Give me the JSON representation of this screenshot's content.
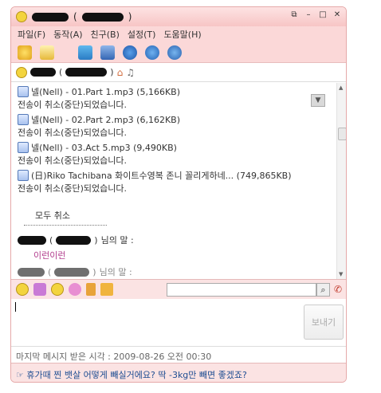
{
  "window": {
    "title_paren_open": "(",
    "title_paren_close": ")",
    "controls": [
      "⧉",
      "–",
      "□",
      "✕"
    ]
  },
  "menu": [
    "파일(F)",
    "동작(A)",
    "친구(B)",
    "설정(T)",
    "도움말(H)"
  ],
  "contact": {
    "paren_open": "(",
    "paren_close": ")"
  },
  "transfers": [
    {
      "file": "넬(Nell) - 01.Part 1.mp3 (5,166KB)",
      "status": "전송이 취소(중단)되었습니다."
    },
    {
      "file": "넬(Nell) - 02.Part 2.mp3 (6,162KB)",
      "status": "전송이 취소(중단)되었습니다."
    },
    {
      "file": "넬(Nell) - 03.Act 5.mp3 (9,490KB)",
      "status": "전송이 취소(중단)되었습니다."
    },
    {
      "file": "(日)Riko Tachibana 화이트수영복 존니 꼴리게하네... (749,865KB)",
      "status": "전송이 취소(중단)되었습니다."
    }
  ],
  "cancel_all": "모두 취소",
  "message": {
    "sender_paren_open": "(",
    "sender_paren_close": ")",
    "says": "님의 말 :",
    "text": "이런이런",
    "next_says": "님의 말 :"
  },
  "send_button": "보내기",
  "last_message": "마지막 메시지 받은 시각 : 2009-08-26 오전 00:30",
  "ad": "☞ 휴가때 찐 뱃살 어떻게 빼실거에요? 딱 -3kg만 빼면 좋겠죠?",
  "colors": {
    "title_bg": "#f7c5c5",
    "menu_bg": "#fbd8d8",
    "message_text": "#b3408f",
    "ad_text": "#1e4d92"
  }
}
